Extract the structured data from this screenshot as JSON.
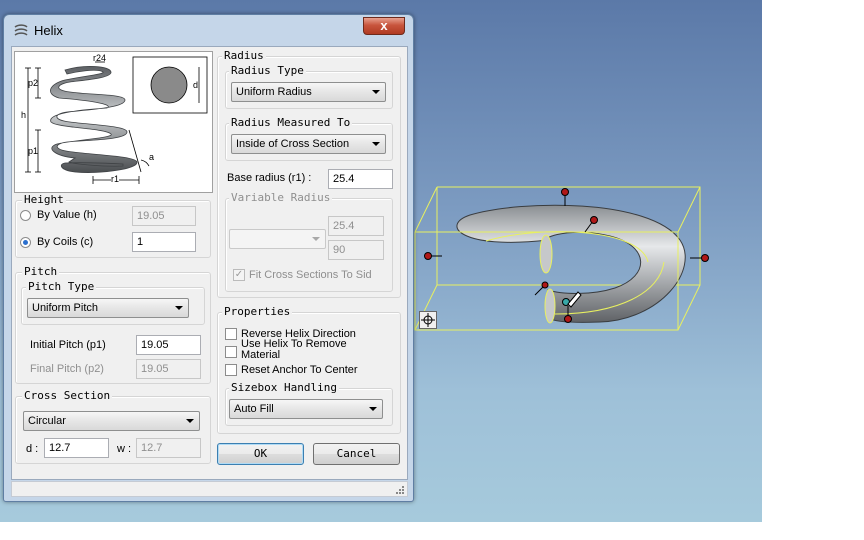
{
  "window": {
    "title": "Helix",
    "close_glyph": "x"
  },
  "diagram": {
    "labels": {
      "r24": "r24",
      "p2": "p2",
      "h": "h",
      "p1": "p1",
      "a": "a",
      "r1": "r1",
      "d": "d"
    }
  },
  "height_group": {
    "legend": "Height",
    "by_value_label": "By Value (h)",
    "by_value_value": "19.05",
    "by_coils_label": "By Coils (c)",
    "by_coils_value": "1",
    "selected": "by_coils"
  },
  "pitch_group": {
    "legend": "Pitch",
    "pitch_type_legend": "Pitch Type",
    "pitch_type_value": "Uniform Pitch",
    "initial_pitch_label": "Initial Pitch (p1)",
    "initial_pitch_value": "19.05",
    "final_pitch_label": "Final Pitch (p2)",
    "final_pitch_value": "19.05"
  },
  "cross_section_group": {
    "legend": "Cross Section",
    "shape_value": "Circular",
    "d_label": "d :",
    "d_value": "12.7",
    "w_label": "w :",
    "w_value": "12.7"
  },
  "radius_group": {
    "legend": "Radius",
    "radius_type_legend": "Radius Type",
    "radius_type_value": "Uniform Radius",
    "measured_to_legend": "Radius Measured To",
    "measured_to_value": "Inside of Cross Section",
    "base_radius_label": "Base radius (r1) :",
    "base_radius_value": "25.4",
    "variable_radius_legend": "Variable Radius",
    "variable_value_1": "25.4",
    "variable_value_2": "90",
    "fit_cross_label": "Fit Cross Sections To Sid",
    "fit_cross_checked": true
  },
  "properties_group": {
    "legend": "Properties",
    "reverse_label": "Reverse Helix Direction",
    "use_helix_label": "Use Helix To Remove Material",
    "reset_anchor_label": "Reset Anchor To Center"
  },
  "sizebox_group": {
    "legend": "Sizebox Handling",
    "value": "Auto Fill"
  },
  "buttons": {
    "ok": "OK",
    "cancel": "Cancel"
  },
  "colors": {
    "viewport_top": "#5b79a8",
    "viewport_bottom": "#a6cadc",
    "sizebox": "#e8f060",
    "handle": "#b01818"
  }
}
